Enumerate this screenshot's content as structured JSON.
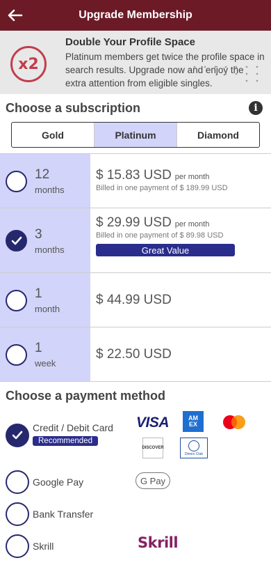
{
  "header": {
    "title": "Upgrade Membership"
  },
  "promo": {
    "badge": "x2",
    "title": "Double Your Profile Space",
    "description": "Platinum members get twice the profile space in search results. Upgrade now and enjoy the extra attention from eligible singles."
  },
  "subscription": {
    "title": "Choose a subscription",
    "tabs": [
      {
        "label": "Gold",
        "active": false
      },
      {
        "label": "Platinum",
        "active": true
      },
      {
        "label": "Diamond",
        "active": false
      }
    ],
    "plans": [
      {
        "number": "12",
        "unit": "months",
        "price": "$ 15.83 USD",
        "per": "per month",
        "billed": "Billed in one payment of $ 189.99 USD",
        "badge": "",
        "selected": false
      },
      {
        "number": "3",
        "unit": "months",
        "price": "$ 29.99 USD",
        "per": "per month",
        "billed": "Billed in one payment of $ 89.98 USD",
        "badge": "Great Value",
        "selected": true
      },
      {
        "number": "1",
        "unit": "month",
        "price": "$ 44.99 USD",
        "per": "",
        "billed": "",
        "badge": "",
        "selected": false
      },
      {
        "number": "1",
        "unit": "week",
        "price": "$ 22.50 USD",
        "per": "",
        "billed": "",
        "badge": "",
        "selected": false
      }
    ]
  },
  "payment": {
    "title": "Choose a payment method",
    "methods": [
      {
        "label": "Credit / Debit Card",
        "recommended": "Recommended",
        "selected": true
      },
      {
        "label": "Google Pay",
        "selected": false
      },
      {
        "label": "Bank Transfer",
        "selected": false
      },
      {
        "label": "Skrill",
        "selected": false
      }
    ],
    "logos": {
      "visa": "VISA",
      "amex_line1": "AM",
      "amex_line2": "EX",
      "discover": "DISCOVER",
      "diners": "Diners Club",
      "gpay": "G Pay",
      "skrill": "Skrill"
    }
  },
  "colors": {
    "header": "#6b1a26",
    "accent": "#26286e",
    "highlight": "#d3d4fa",
    "badge": "#2a2d8c"
  }
}
